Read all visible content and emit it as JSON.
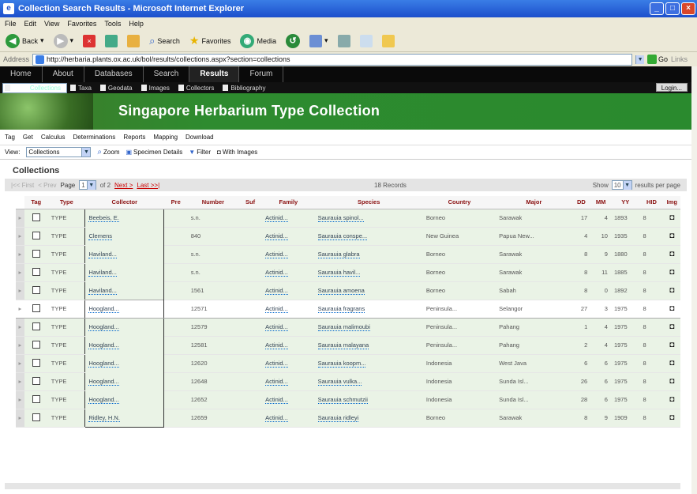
{
  "window": {
    "title": "Collection Search Results - Microsoft Internet Explorer"
  },
  "menu": [
    "File",
    "Edit",
    "View",
    "Favorites",
    "Tools",
    "Help"
  ],
  "toolbar": {
    "back": "Back",
    "search": "Search",
    "favorites": "Favorites",
    "media": "Media"
  },
  "address": {
    "label": "Address",
    "url": "http://herbaria.plants.ox.ac.uk/bol/results/collections.aspx?section=collections",
    "go": "Go",
    "links": "Links"
  },
  "nav": {
    "items": [
      "Home",
      "About",
      "Databases",
      "Search",
      "Results",
      "Forum"
    ],
    "active": "Results"
  },
  "subnav": {
    "items": [
      "Collections",
      "Taxa",
      "Geodata",
      "Images",
      "Collectors",
      "Bibliography"
    ],
    "login": "Login..."
  },
  "banner": {
    "title": "Singapore Herbarium Type Collection"
  },
  "appmenu": [
    "Tag",
    "Get",
    "Calculus",
    "Determinations",
    "Reports",
    "Mapping",
    "Download"
  ],
  "view": {
    "label": "View:",
    "selected": "Collections",
    "zoom": "Zoom",
    "specimen": "Specimen Details",
    "filter": "Filter",
    "image": "With Images"
  },
  "collections_title": "Collections",
  "pager": {
    "first": "|<< First",
    "prev": "< Prev",
    "page_label": "Page",
    "page": "1",
    "of": "of 2",
    "next": "Next >",
    "last": "Last >>|",
    "records": "18 Records",
    "show": "Show",
    "show_value": "10",
    "per_page": "results per page"
  },
  "table": {
    "headers": [
      "Tag",
      "Type",
      "Collector",
      "Pre",
      "Number",
      "Suf",
      "Family",
      "Species",
      "Country",
      "Major",
      "DD",
      "MM",
      "YY",
      "HID",
      "Img"
    ],
    "rows": [
      {
        "type": "TYPE",
        "collector": "Beebeis, E.",
        "number": "s.n.",
        "family": "Actinid...",
        "species": "Saurauia spinol...",
        "country": "Borneo",
        "major": "Sarawak",
        "dd": "17",
        "mm": "4",
        "yy": "1893",
        "hid": "8"
      },
      {
        "type": "TYPE",
        "collector": "Clemens",
        "number": "840",
        "family": "Actinid...",
        "species": "Saurauia conspe...",
        "country": "New Guinea",
        "major": "Papua New...",
        "dd": "4",
        "mm": "10",
        "yy": "1935",
        "hid": "8"
      },
      {
        "type": "TYPE",
        "collector": "Haviland...",
        "number": "s.n.",
        "family": "Actinid...",
        "species": "Saurauia glabra",
        "country": "Borneo",
        "major": "Sarawak",
        "dd": "8",
        "mm": "9",
        "yy": "1880",
        "hid": "8"
      },
      {
        "type": "TYPE",
        "collector": "Haviland...",
        "number": "s.n.",
        "family": "Actinid...",
        "species": "Saurauia havil...",
        "country": "Borneo",
        "major": "Sarawak",
        "dd": "8",
        "mm": "11",
        "yy": "1885",
        "hid": "8"
      },
      {
        "type": "TYPE",
        "collector": "Haviland...",
        "number": "1561",
        "family": "Actinid...",
        "species": "Saurauia amoena",
        "country": "Borneo",
        "major": "Sabah",
        "dd": "8",
        "mm": "0",
        "yy": "1892",
        "hid": "8"
      },
      {
        "type": "TYPE",
        "collector": "Hoogland...",
        "number": "12571",
        "family": "Actinid...",
        "species": "Saurauia fragrans",
        "country": "Peninsula...",
        "major": "Selangor",
        "dd": "27",
        "mm": "3",
        "yy": "1975",
        "hid": "8"
      },
      {
        "type": "TYPE",
        "collector": "Hoogland...",
        "number": "12579",
        "family": "Actinid...",
        "species": "Saurauia malimoubi",
        "country": "Peninsula...",
        "major": "Pahang",
        "dd": "1",
        "mm": "4",
        "yy": "1975",
        "hid": "8"
      },
      {
        "type": "TYPE",
        "collector": "Hoogland...",
        "number": "12581",
        "family": "Actinid...",
        "species": "Saurauia malayana",
        "country": "Peninsula...",
        "major": "Pahang",
        "dd": "2",
        "mm": "4",
        "yy": "1975",
        "hid": "8"
      },
      {
        "type": "TYPE",
        "collector": "Hoogland...",
        "number": "12620",
        "family": "Actinid...",
        "species": "Saurauia koopm...",
        "country": "Indonesia",
        "major": "West Java",
        "dd": "6",
        "mm": "6",
        "yy": "1975",
        "hid": "8"
      },
      {
        "type": "TYPE",
        "collector": "Hoogland...",
        "number": "12648",
        "family": "Actinid...",
        "species": "Saurauia vulka...",
        "country": "Indonesia",
        "major": "Sunda Isl...",
        "dd": "26",
        "mm": "6",
        "yy": "1975",
        "hid": "8"
      },
      {
        "type": "TYPE",
        "collector": "Hoogland...",
        "number": "12652",
        "family": "Actinid...",
        "species": "Saurauia schmutzii",
        "country": "Indonesia",
        "major": "Sunda Isl...",
        "dd": "28",
        "mm": "6",
        "yy": "1975",
        "hid": "8"
      },
      {
        "type": "TYPE",
        "collector": "Ridley, H.N.",
        "number": "12659",
        "family": "Actinid...",
        "species": "Saurauia ridleyi",
        "country": "Borneo",
        "major": "Sarawak",
        "dd": "8",
        "mm": "9",
        "yy": "1909",
        "hid": "8"
      }
    ]
  }
}
